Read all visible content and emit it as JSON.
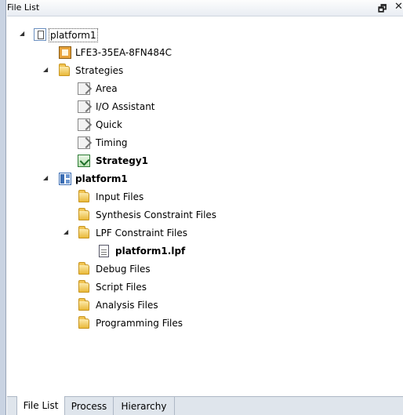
{
  "panel": {
    "title": "File List",
    "float_glyph": "🗗",
    "close_glyph": "✕"
  },
  "tree": {
    "project": {
      "label": "platform1",
      "expanded": true,
      "selected": true
    },
    "device": {
      "label": "LFE3-35EA-8FN484C"
    },
    "strategies": {
      "label": "Strategies",
      "items": [
        {
          "label": "Area",
          "active": false
        },
        {
          "label": "I/O Assistant",
          "active": false
        },
        {
          "label": "Quick",
          "active": false
        },
        {
          "label": "Timing",
          "active": false
        },
        {
          "label": "Strategy1",
          "active": true
        }
      ]
    },
    "implementation": {
      "label": "platform1",
      "folders": [
        {
          "label": "Input Files"
        },
        {
          "label": "Synthesis Constraint Files"
        },
        {
          "label": "LPF Constraint Files",
          "expanded": true,
          "children": [
            {
              "label": "platform1.lpf"
            }
          ]
        },
        {
          "label": "Debug Files"
        },
        {
          "label": "Script Files"
        },
        {
          "label": "Analysis Files"
        },
        {
          "label": "Programming Files"
        }
      ]
    }
  },
  "tabs": [
    {
      "label": "File List",
      "active": true
    },
    {
      "label": "Process",
      "active": false
    },
    {
      "label": "Hierarchy",
      "active": false
    }
  ],
  "icons": {
    "expand_arrow": "◢"
  }
}
